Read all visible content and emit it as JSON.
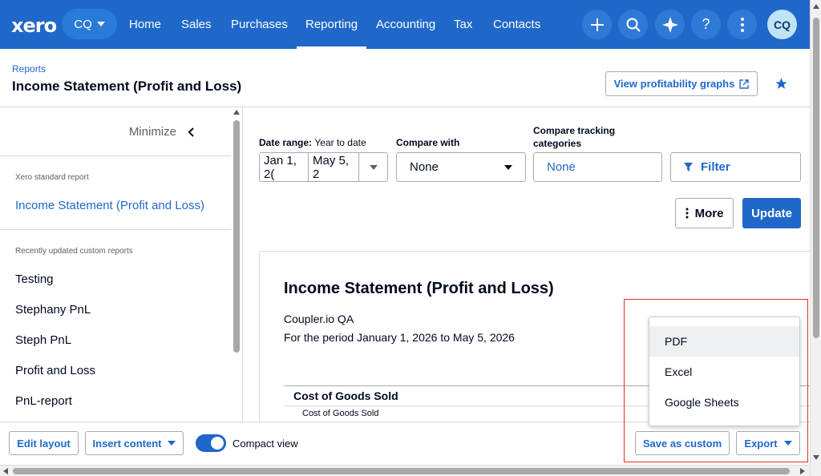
{
  "nav": {
    "logo": "xero",
    "org": "CQ",
    "links": [
      "Home",
      "Sales",
      "Purchases",
      "Reporting",
      "Accounting",
      "Tax",
      "Contacts"
    ],
    "active": "Reporting",
    "icons": [
      "plus-icon",
      "search-icon",
      "ai-sparkle-icon",
      "help-icon",
      "more-vertical-icon"
    ],
    "avatar": "CQ"
  },
  "header": {
    "breadcrumb": "Reports",
    "title": "Income Statement (Profit and Loss)",
    "graphs_button": "View profitability graphs"
  },
  "sidebar": {
    "minimize": "Minimize",
    "standard_label": "Xero standard report",
    "standard_report": "Income Statement (Profit and Loss)",
    "custom_label": "Recently updated custom reports",
    "custom_reports": [
      "Testing",
      "Stephany PnL",
      "Steph PnL",
      "Profit and Loss",
      "PnL-report"
    ]
  },
  "controls": {
    "date_range_label": "Date range:",
    "date_range_value": "Year to date",
    "date_from": "Jan 1, 2(",
    "date_to": "May 5, 2",
    "compare_label": "Compare with",
    "compare_value": "None",
    "tracking_label": "Compare tracking categories",
    "tracking_value": "None",
    "filter": "Filter",
    "more": "More",
    "update": "Update"
  },
  "report": {
    "title": "Income Statement (Profit and Loss)",
    "org": "Coupler.io QA",
    "period": "For the period January 1, 2026 to May 5, 2026",
    "section": "Cost of Goods Sold",
    "row": "Cost of Goods Sold"
  },
  "footer": {
    "edit_layout": "Edit layout",
    "insert_content": "Insert content",
    "compact_view": "Compact view",
    "save_custom": "Save as custom",
    "export": "Export"
  },
  "export_menu": [
    "PDF",
    "Excel",
    "Google Sheets"
  ],
  "colors": {
    "brand": "#1f68c9",
    "highlight": "#e0312b"
  }
}
